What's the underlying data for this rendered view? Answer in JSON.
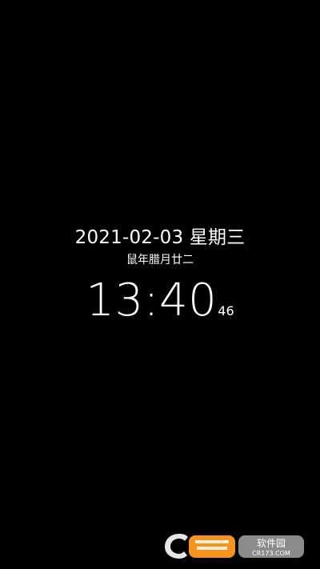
{
  "lockscreen": {
    "date_text": "2021-02-03 星期三",
    "lunar_text": "鼠年腊月廿二",
    "time_hm": "13:40",
    "time_seconds": "46"
  },
  "watermark": {
    "brand_text": "软件园",
    "domain_text": "CR173.COM",
    "colors": {
      "orange": "#f7941d",
      "gray": "#9a9a9a",
      "white": "#ffffff"
    },
    "icon": "ccr-logo-icon"
  }
}
